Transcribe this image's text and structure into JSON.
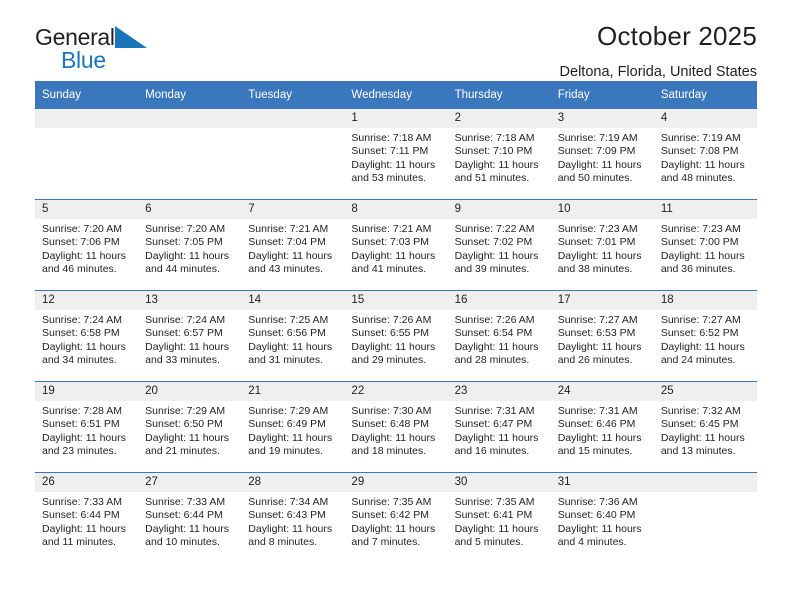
{
  "brand": {
    "word1": "General",
    "word2": "Blue",
    "triangle_color": "#1b75bb",
    "text_color": "#231f20"
  },
  "header": {
    "title": "October 2025",
    "subtitle": "Deltona, Florida, United States"
  },
  "theme": {
    "header_blue": "#3a77bc",
    "daynum_gray": "#efefef",
    "text": "#231f20"
  },
  "calendar": {
    "weekday_headers": [
      "Sunday",
      "Monday",
      "Tuesday",
      "Wednesday",
      "Thursday",
      "Friday",
      "Saturday"
    ],
    "weeks": [
      [
        {
          "day": "",
          "lines": []
        },
        {
          "day": "",
          "lines": []
        },
        {
          "day": "",
          "lines": []
        },
        {
          "day": "1",
          "lines": [
            "Sunrise: 7:18 AM",
            "Sunset: 7:11 PM",
            "Daylight: 11 hours",
            "and 53 minutes."
          ]
        },
        {
          "day": "2",
          "lines": [
            "Sunrise: 7:18 AM",
            "Sunset: 7:10 PM",
            "Daylight: 11 hours",
            "and 51 minutes."
          ]
        },
        {
          "day": "3",
          "lines": [
            "Sunrise: 7:19 AM",
            "Sunset: 7:09 PM",
            "Daylight: 11 hours",
            "and 50 minutes."
          ]
        },
        {
          "day": "4",
          "lines": [
            "Sunrise: 7:19 AM",
            "Sunset: 7:08 PM",
            "Daylight: 11 hours",
            "and 48 minutes."
          ]
        }
      ],
      [
        {
          "day": "5",
          "lines": [
            "Sunrise: 7:20 AM",
            "Sunset: 7:06 PM",
            "Daylight: 11 hours",
            "and 46 minutes."
          ]
        },
        {
          "day": "6",
          "lines": [
            "Sunrise: 7:20 AM",
            "Sunset: 7:05 PM",
            "Daylight: 11 hours",
            "and 44 minutes."
          ]
        },
        {
          "day": "7",
          "lines": [
            "Sunrise: 7:21 AM",
            "Sunset: 7:04 PM",
            "Daylight: 11 hours",
            "and 43 minutes."
          ]
        },
        {
          "day": "8",
          "lines": [
            "Sunrise: 7:21 AM",
            "Sunset: 7:03 PM",
            "Daylight: 11 hours",
            "and 41 minutes."
          ]
        },
        {
          "day": "9",
          "lines": [
            "Sunrise: 7:22 AM",
            "Sunset: 7:02 PM",
            "Daylight: 11 hours",
            "and 39 minutes."
          ]
        },
        {
          "day": "10",
          "lines": [
            "Sunrise: 7:23 AM",
            "Sunset: 7:01 PM",
            "Daylight: 11 hours",
            "and 38 minutes."
          ]
        },
        {
          "day": "11",
          "lines": [
            "Sunrise: 7:23 AM",
            "Sunset: 7:00 PM",
            "Daylight: 11 hours",
            "and 36 minutes."
          ]
        }
      ],
      [
        {
          "day": "12",
          "lines": [
            "Sunrise: 7:24 AM",
            "Sunset: 6:58 PM",
            "Daylight: 11 hours",
            "and 34 minutes."
          ]
        },
        {
          "day": "13",
          "lines": [
            "Sunrise: 7:24 AM",
            "Sunset: 6:57 PM",
            "Daylight: 11 hours",
            "and 33 minutes."
          ]
        },
        {
          "day": "14",
          "lines": [
            "Sunrise: 7:25 AM",
            "Sunset: 6:56 PM",
            "Daylight: 11 hours",
            "and 31 minutes."
          ]
        },
        {
          "day": "15",
          "lines": [
            "Sunrise: 7:26 AM",
            "Sunset: 6:55 PM",
            "Daylight: 11 hours",
            "and 29 minutes."
          ]
        },
        {
          "day": "16",
          "lines": [
            "Sunrise: 7:26 AM",
            "Sunset: 6:54 PM",
            "Daylight: 11 hours",
            "and 28 minutes."
          ]
        },
        {
          "day": "17",
          "lines": [
            "Sunrise: 7:27 AM",
            "Sunset: 6:53 PM",
            "Daylight: 11 hours",
            "and 26 minutes."
          ]
        },
        {
          "day": "18",
          "lines": [
            "Sunrise: 7:27 AM",
            "Sunset: 6:52 PM",
            "Daylight: 11 hours",
            "and 24 minutes."
          ]
        }
      ],
      [
        {
          "day": "19",
          "lines": [
            "Sunrise: 7:28 AM",
            "Sunset: 6:51 PM",
            "Daylight: 11 hours",
            "and 23 minutes."
          ]
        },
        {
          "day": "20",
          "lines": [
            "Sunrise: 7:29 AM",
            "Sunset: 6:50 PM",
            "Daylight: 11 hours",
            "and 21 minutes."
          ]
        },
        {
          "day": "21",
          "lines": [
            "Sunrise: 7:29 AM",
            "Sunset: 6:49 PM",
            "Daylight: 11 hours",
            "and 19 minutes."
          ]
        },
        {
          "day": "22",
          "lines": [
            "Sunrise: 7:30 AM",
            "Sunset: 6:48 PM",
            "Daylight: 11 hours",
            "and 18 minutes."
          ]
        },
        {
          "day": "23",
          "lines": [
            "Sunrise: 7:31 AM",
            "Sunset: 6:47 PM",
            "Daylight: 11 hours",
            "and 16 minutes."
          ]
        },
        {
          "day": "24",
          "lines": [
            "Sunrise: 7:31 AM",
            "Sunset: 6:46 PM",
            "Daylight: 11 hours",
            "and 15 minutes."
          ]
        },
        {
          "day": "25",
          "lines": [
            "Sunrise: 7:32 AM",
            "Sunset: 6:45 PM",
            "Daylight: 11 hours",
            "and 13 minutes."
          ]
        }
      ],
      [
        {
          "day": "26",
          "lines": [
            "Sunrise: 7:33 AM",
            "Sunset: 6:44 PM",
            "Daylight: 11 hours",
            "and 11 minutes."
          ]
        },
        {
          "day": "27",
          "lines": [
            "Sunrise: 7:33 AM",
            "Sunset: 6:44 PM",
            "Daylight: 11 hours",
            "and 10 minutes."
          ]
        },
        {
          "day": "28",
          "lines": [
            "Sunrise: 7:34 AM",
            "Sunset: 6:43 PM",
            "Daylight: 11 hours",
            "and 8 minutes."
          ]
        },
        {
          "day": "29",
          "lines": [
            "Sunrise: 7:35 AM",
            "Sunset: 6:42 PM",
            "Daylight: 11 hours",
            "and 7 minutes."
          ]
        },
        {
          "day": "30",
          "lines": [
            "Sunrise: 7:35 AM",
            "Sunset: 6:41 PM",
            "Daylight: 11 hours",
            "and 5 minutes."
          ]
        },
        {
          "day": "31",
          "lines": [
            "Sunrise: 7:36 AM",
            "Sunset: 6:40 PM",
            "Daylight: 11 hours",
            "and 4 minutes."
          ]
        },
        {
          "day": "",
          "lines": []
        }
      ]
    ]
  }
}
